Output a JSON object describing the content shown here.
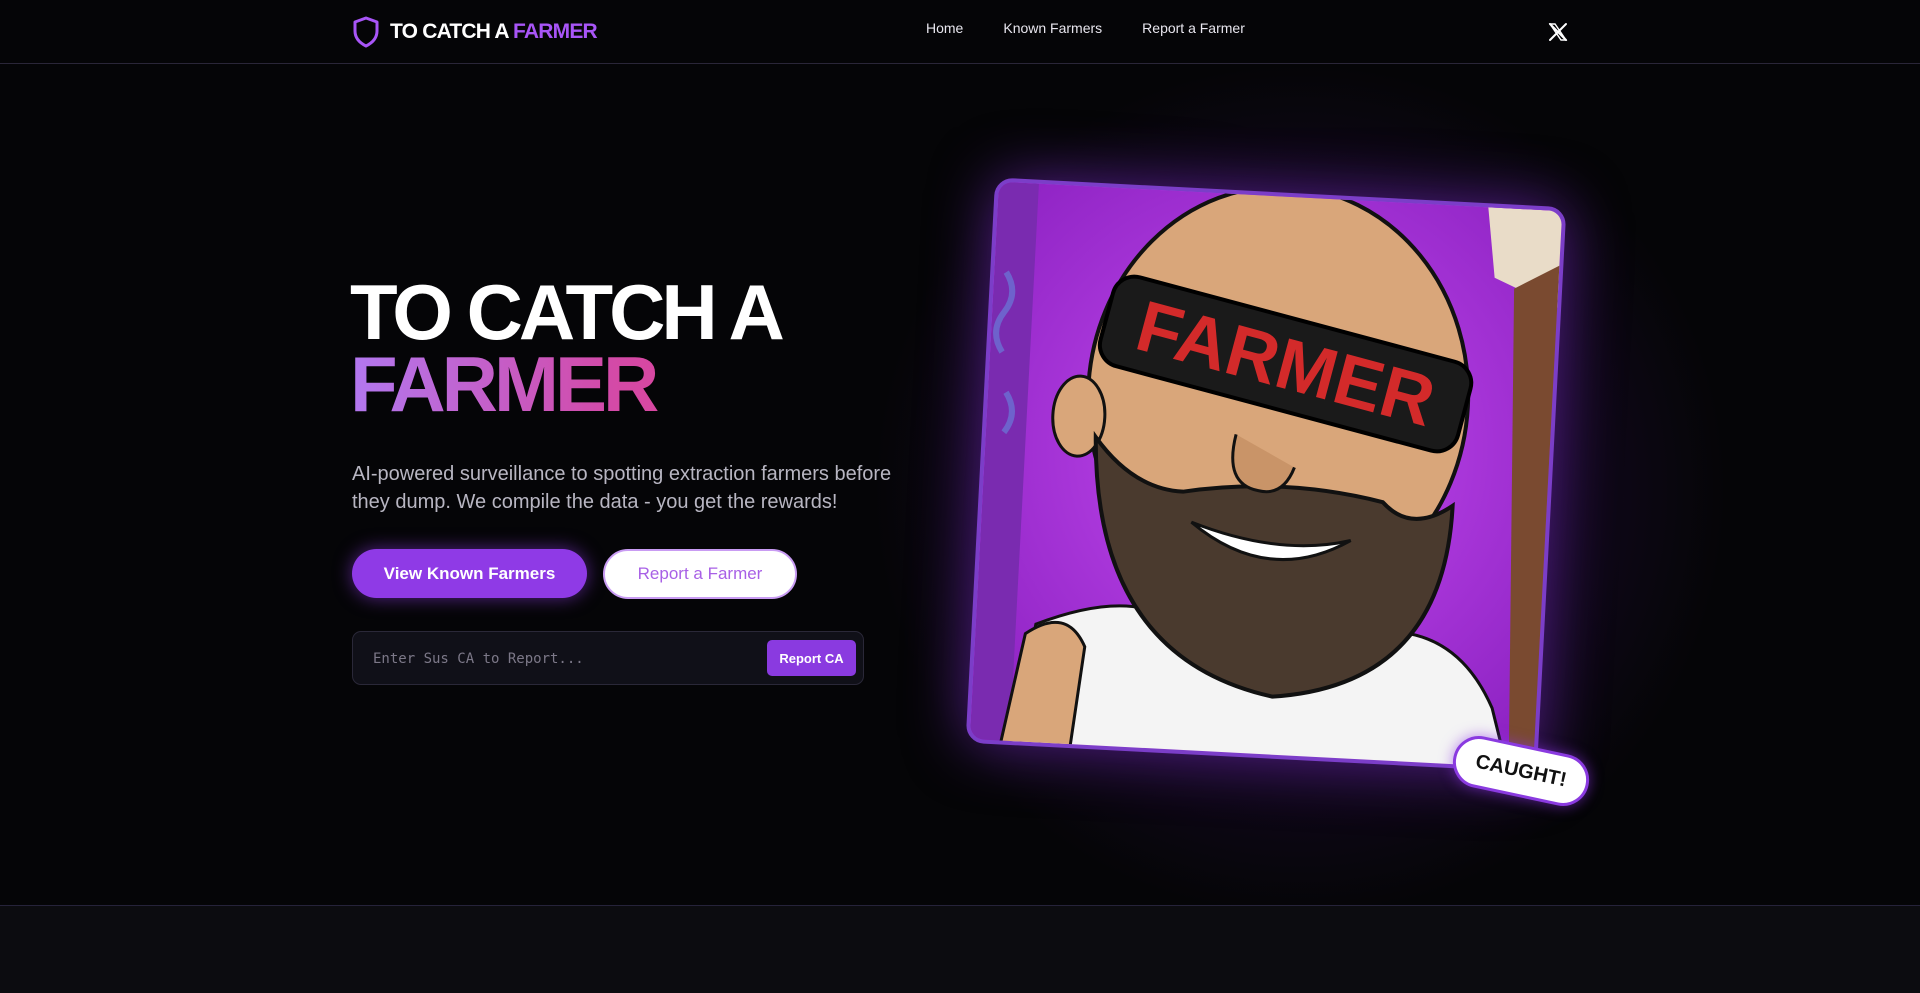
{
  "nav": {
    "brand_main": "TO CATCH A",
    "brand_highlight": "FARMER",
    "links": [
      "Home",
      "Known Farmers",
      "Report a Farmer"
    ],
    "social_icon": "x-logo-icon",
    "brand_icon": "shield-icon"
  },
  "hero": {
    "title_line1": "TO CATCH A",
    "title_line2": "FARMER",
    "subtitle": "AI-powered surveillance to spotting extraction farmers before they dump. We compile the data - you get the rewards!",
    "primary_button": "View Known Farmers",
    "secondary_button": "Report a Farmer",
    "ca_placeholder": "Enter Sus CA to Report...",
    "ca_button": "Report CA"
  },
  "card": {
    "glasses_text": "FARMER",
    "badge": "CAUGHT!"
  },
  "colors": {
    "accent": "#8f3ae6",
    "background": "#050507",
    "gradient_start": "#b278f0",
    "gradient_end": "#e23f8e"
  }
}
